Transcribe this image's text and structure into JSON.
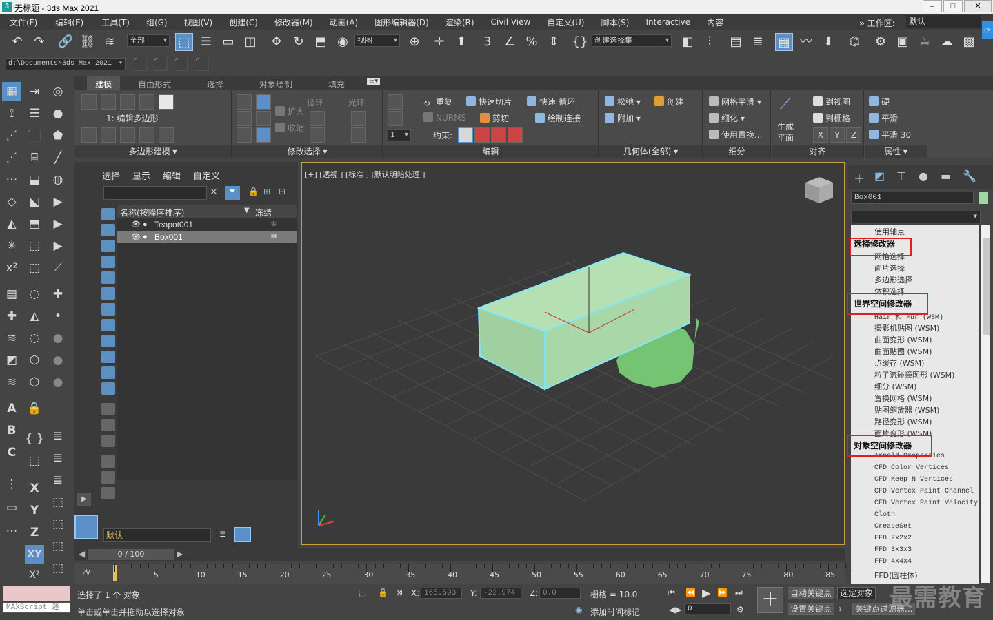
{
  "title": {
    "icon": "3",
    "text": "无标题 - 3ds Max 2021"
  },
  "window": {
    "min": "–",
    "max": "□",
    "close": "✕"
  },
  "menu": [
    "文件(F)",
    "编辑(E)",
    "工具(T)",
    "组(G)",
    "视图(V)",
    "创建(C)",
    "修改器(M)",
    "动画(A)",
    "图形编辑器(D)",
    "渲染(R)",
    "Civil View",
    "自定义(U)",
    "脚本(S)",
    "Interactive",
    "内容"
  ],
  "workspace": {
    "chevron": "»",
    "label": "工作区:",
    "value": "默认"
  },
  "toolbar": {
    "selection_filter": "全部",
    "view_ref": "视图",
    "named_sel": "创建选择集",
    "path": "d:\\Documents\\3ds Max 2021"
  },
  "ribbon": {
    "tabs": [
      "建模",
      "自由形式",
      "选择",
      "对象绘制",
      "填充"
    ],
    "poly_level": "1: 编辑多边形",
    "sections": [
      "多边形建模 ▾",
      "修改选择 ▾",
      "编辑",
      "几何体(全部) ▾",
      "细分",
      "对齐",
      "属性 ▾"
    ],
    "modsel": {
      "grow": "扩大",
      "shrink": "收缩",
      "loop": "循环",
      "ring": "光环"
    },
    "edit": {
      "repeat": "重复",
      "quickslice": "快速切片",
      "quickloop": "快速 循环",
      "nurms": "NURMS",
      "cut": "剪切",
      "paintconnect": "绘制连接",
      "constraint": "约束:",
      "spinner": "1"
    },
    "geom": {
      "relax": "松弛",
      "create": "创建",
      "attach": "附加"
    },
    "subdiv": {
      "meshsmooth": "网格平滑",
      "tessellate": "细化",
      "usedisp": "使用置换..."
    },
    "align": {
      "genplane": "生成",
      "genplane2": "平面",
      "toview": "到视图",
      "togrid": "到栅格",
      "x": "X",
      "y": "Y",
      "z": "Z"
    },
    "props": {
      "hard": "硬",
      "smooth": "平滑",
      "smooth30": "平滑 30"
    }
  },
  "explorer": {
    "menu": [
      "选择",
      "显示",
      "编辑",
      "自定义"
    ],
    "col_name": "名称(按降序排序)",
    "col_freeze": "冻结",
    "rows": [
      {
        "name": "Teapot001",
        "eye": "👁 ●",
        "freeze": "❄"
      },
      {
        "name": "Box001",
        "eye": "👁 ●",
        "freeze": "❄"
      }
    ],
    "layer": "默认"
  },
  "viewport": {
    "label": "[+] [透视 ] [标准 ] [默认明暗处理 ]"
  },
  "cmd": {
    "objname": "Box001",
    "modifiers": [
      {
        "t": "使用轴点",
        "k": "item"
      },
      {
        "t": "选择修改器",
        "k": "hdr"
      },
      {
        "t": "网格选择",
        "k": "item"
      },
      {
        "t": "面片选择",
        "k": "item"
      },
      {
        "t": "多边形选择",
        "k": "item"
      },
      {
        "t": "体积选择",
        "k": "item"
      },
      {
        "t": "世界空间修改器",
        "k": "hdr"
      },
      {
        "t": "Hair 和 Fur (WSM)",
        "k": "mono"
      },
      {
        "t": "摄影机贴图 (WSM)",
        "k": "item"
      },
      {
        "t": "曲面变形 (WSM)",
        "k": "item"
      },
      {
        "t": "曲面贴图 (WSM)",
        "k": "item"
      },
      {
        "t": "点缓存 (WSM)",
        "k": "item"
      },
      {
        "t": "粒子流碰撞图形 (WSM)",
        "k": "item"
      },
      {
        "t": "细分 (WSM)",
        "k": "item"
      },
      {
        "t": "置换网格 (WSM)",
        "k": "item"
      },
      {
        "t": "贴图缩放器 (WSM)",
        "k": "item"
      },
      {
        "t": "路径变形 (WSM)",
        "k": "item"
      },
      {
        "t": "面片变形 (WSM)",
        "k": "item"
      },
      {
        "t": "对象空间修改器",
        "k": "hdr"
      },
      {
        "t": "Arnold Properties",
        "k": "mono"
      },
      {
        "t": "CFD Color Vertices",
        "k": "mono"
      },
      {
        "t": "CFD Keep N Vertices",
        "k": "mono"
      },
      {
        "t": "CFD Vertex Paint Channel",
        "k": "mono"
      },
      {
        "t": "CFD Vertex Paint Velocity",
        "k": "mono"
      },
      {
        "t": "Cloth",
        "k": "mono"
      },
      {
        "t": "CreaseSet",
        "k": "mono"
      },
      {
        "t": "FFD 2x2x2",
        "k": "mono"
      },
      {
        "t": "FFD 3x3x3",
        "k": "mono"
      },
      {
        "t": "FFD 4x4x4",
        "k": "mono"
      },
      {
        "t": "FFD(圆柱体)",
        "k": "item"
      }
    ]
  },
  "timeline": {
    "slider": "0 / 100",
    "ticks": [
      "5",
      "10",
      "15",
      "20",
      "25",
      "30",
      "35",
      "40",
      "45",
      "50",
      "55",
      "60",
      "65",
      "70",
      "75",
      "80",
      "85"
    ]
  },
  "status": {
    "maxscript": "MAXScript 迷",
    "selected": "选择了 1 个 对象",
    "prompt": "单击或单击并拖动以选择对象",
    "x": "165.593",
    "y": "-22.974",
    "z": "0.0",
    "grid": "栅格 = 10.0",
    "addtime": "添加时间标记",
    "autokey": "自动关键点",
    "setkey": "设置关键点",
    "selobj": "选定对象",
    "keyfilter": "关键点过滤器...",
    "frame": "0"
  },
  "watermark": "最需教育",
  "colors": {
    "accent": "#5b8fc7",
    "selection": "#7fe8ff",
    "box": "#a8d8a8",
    "teapot": "#7cc87c",
    "highlight": "#e02020"
  }
}
